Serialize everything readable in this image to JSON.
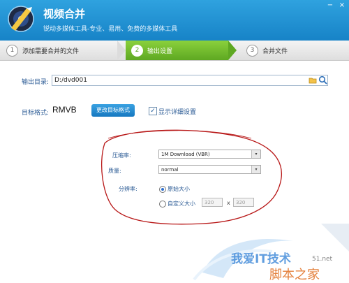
{
  "app": {
    "title": "视频合并",
    "subtitle": "锐动多媒体工具-专业、易用、免费的多媒体工具"
  },
  "window_controls": {
    "minimize": "−",
    "close": "×"
  },
  "steps": [
    {
      "num": "1",
      "label": "添加需要合并的文件"
    },
    {
      "num": "2",
      "label": "输出设置"
    },
    {
      "num": "3",
      "label": "合并文件"
    }
  ],
  "output": {
    "dir_label": "输出目录:",
    "dir_value": "D:/dvd001"
  },
  "format": {
    "label": "目标格式:",
    "value": "RMVB",
    "change_button": "更改目标格式",
    "details_label": "显示详细设置",
    "details_checked": true
  },
  "details": {
    "compression_label": "压缩率:",
    "compression_value": "1M Download (VBR)",
    "quality_label": "质量:",
    "quality_value": "normal",
    "resolution_label": "分辨率:",
    "original_size_label": "原始大小",
    "custom_size_label": "自定义大小",
    "custom_width": "320",
    "times": "x",
    "custom_height": "320"
  },
  "watermark": {
    "text1": "我爱IT技术",
    "text2": "脚本之家",
    "text3": "51.net"
  },
  "colors": {
    "header_blue": "#1a8ad4",
    "active_step_green": "#6bb52a",
    "annotation_red": "#b81818"
  }
}
